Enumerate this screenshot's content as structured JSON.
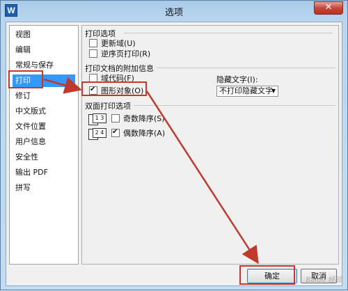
{
  "window": {
    "title": "选项",
    "logo_letter": "W",
    "close_symbol": "✕"
  },
  "sidebar": {
    "items": [
      {
        "label": "视图",
        "selected": false
      },
      {
        "label": "编辑",
        "selected": false
      },
      {
        "label": "常规与保存",
        "selected": false
      },
      {
        "label": "打印",
        "selected": true
      },
      {
        "label": "修订",
        "selected": false
      },
      {
        "label": "中文版式",
        "selected": false
      },
      {
        "label": "文件位置",
        "selected": false
      },
      {
        "label": "用户信息",
        "selected": false
      },
      {
        "label": "安全性",
        "selected": false
      },
      {
        "label": "输出 PDF",
        "selected": false
      },
      {
        "label": "拼写",
        "selected": false
      }
    ]
  },
  "print_options": {
    "title": "打印选项",
    "update_fields": {
      "label": "更新域(U)",
      "checked": false
    },
    "reverse_order": {
      "label": "逆序页打印(R)",
      "checked": false
    }
  },
  "extra_info": {
    "title": "打印文档的附加信息",
    "field_codes": {
      "label": "域代码(F)",
      "checked": false
    },
    "drawing_objects": {
      "label": "图形对象(O)",
      "checked": true
    },
    "hidden_text_label": "隐藏文字(I):",
    "hidden_text_value": "不打印隐藏文字"
  },
  "duplex": {
    "title": "双面打印选项",
    "odd_pages": {
      "label": "奇数降序(S)",
      "checked": false,
      "icon_text": "1 3"
    },
    "even_pages": {
      "label": "偶数降序(A)",
      "checked": true,
      "icon_text": "2 4"
    }
  },
  "buttons": {
    "ok": "确定",
    "cancel": "取消"
  },
  "watermark": "Baidu 经验",
  "colors": {
    "annotation": "#c0392b",
    "selection": "#3399ff"
  }
}
